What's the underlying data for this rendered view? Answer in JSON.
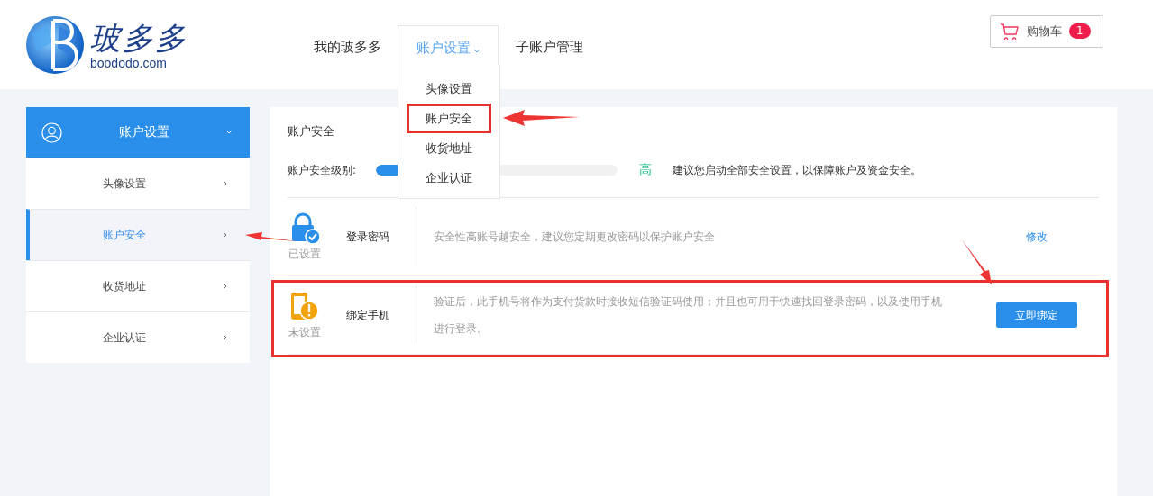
{
  "logo": {
    "name": "玻多多",
    "domain": "boododo.com"
  },
  "nav": [
    {
      "label": "我的玻多多",
      "selected": false,
      "expanded": false
    },
    {
      "label": "账户设置",
      "selected": true,
      "expanded": true
    },
    {
      "label": "子账户管理",
      "selected": false,
      "expanded": false
    }
  ],
  "dropdown": [
    {
      "label": "头像设置",
      "highlighted": false
    },
    {
      "label": "账户安全",
      "highlighted": true
    },
    {
      "label": "收货地址",
      "highlighted": false
    },
    {
      "label": "企业认证",
      "highlighted": false
    }
  ],
  "cart": {
    "label": "购物车",
    "count": "1"
  },
  "sidebar": {
    "title": "账户设置",
    "items": [
      {
        "label": "头像设置",
        "selected": false
      },
      {
        "label": "账户安全",
        "selected": true
      },
      {
        "label": "收货地址",
        "selected": false
      },
      {
        "label": "企业认证",
        "selected": false
      }
    ]
  },
  "security": {
    "title": "账户安全",
    "level_label": "账户安全级别:",
    "level": 0.4,
    "level_text": "高",
    "advice": "建议您启动全部安全设置，以保障账户及资金安全。",
    "items": [
      {
        "kind": "lock",
        "status": "已设置",
        "name": "登录密码",
        "description": "安全性高账号越安全，建议您定期更改密码以保护账户安全",
        "action": "修改",
        "highlighted": false
      },
      {
        "kind": "phone",
        "status": "未设置",
        "name": "绑定手机",
        "description": "验证后，此手机号将作为支付货款时接收短信验证码使用；并且也可用于快速找回登录密码，以及使用手机进行登录。",
        "action": "立即绑定",
        "highlighted": true
      }
    ]
  }
}
